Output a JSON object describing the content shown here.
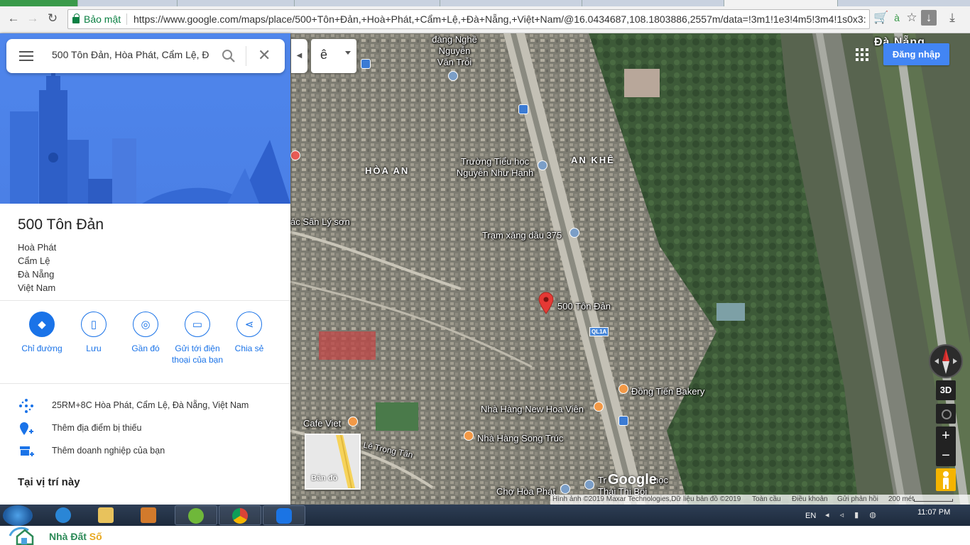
{
  "browser": {
    "secure_label": "Bảo mật",
    "url": "https://www.google.com/maps/place/500+Tôn+Đản,+Hoà+Phát,+Cẩm+Lệ,+Đà+Nẵng,+Việt+Nam/@16.0434687,108.1803886,2557m/data=!3m1!1e3!4m5!3m4!1s0x3:"
  },
  "search": {
    "value": "500 Tôn Đản, Hòa Phát, Cẩm Lệ, Đ"
  },
  "place": {
    "title": "500 Tôn Đản",
    "address_lines": [
      "Hoà Phát",
      "Cẩm Lệ",
      "Đà Nẵng",
      "Việt Nam"
    ]
  },
  "actions": [
    {
      "label": "Chỉ đường",
      "icon": "directions-icon"
    },
    {
      "label": "Lưu",
      "icon": "bookmark-icon"
    },
    {
      "label": "Gần đó",
      "icon": "nearby-icon"
    },
    {
      "label": "Gửi tới điện thoại của bạn",
      "icon": "send-to-phone-icon"
    },
    {
      "label": "Chia sẻ",
      "icon": "share-icon"
    }
  ],
  "info_rows": [
    {
      "text": "25RM+8C Hòa Phát, Cẩm Lệ, Đà Nẵng, Việt Nam",
      "icon": "plus-code-icon"
    },
    {
      "text": "Thêm địa điểm bị thiếu",
      "icon": "add-place-icon"
    },
    {
      "text": "Thêm doanh nghiệp của bạn",
      "icon": "add-business-icon"
    }
  ],
  "here_title": "Tại vị trí này",
  "layer_select": {
    "value": "ê"
  },
  "top_right": {
    "signin": "Đăng nhập",
    "city": "Đà Nẵng"
  },
  "map_labels": {
    "school_top": "đàng Nghề Nguyễn Văn Trỗi",
    "hoa_an": "HÒA AN",
    "an_khe": "AN KHÊ",
    "truong": "Trường Tiểu học Nguyễn Như Hạnh",
    "cac_san": "ác Sân Lý sơn",
    "tram": "Trạm xăng dầu 375",
    "pin": "500 Tôn Đản",
    "road": "QL1A",
    "bakery": "Đồng Tiến Bakery",
    "hoa_vien": "Nhà Hàng New Hoa Viên",
    "cafe": "Cafe Viet",
    "song_truc": "Nhà Hàng Song Trúc",
    "le_trong_tan": "Lê Trọng Tấn",
    "cho": "Chợ Hòa Phát",
    "tr_hoc": "Tr",
    "tr_hoc2": "học",
    "thai_thi": "Thái Thị Bôi"
  },
  "minimap_label": "Bản đồ",
  "map_controls": {
    "three_d": "3D",
    "zoom_in": "+",
    "zoom_out": "−"
  },
  "google_logo": "Google",
  "attribution": {
    "imagery": "Hình ảnh ©2019 Maxar Technologies,Dữ liệu bản đồ ©2019",
    "global": "Toàn cầu",
    "terms": "Điều khoản",
    "feedback": "Gửi phản hồi",
    "scale": "200 mét"
  },
  "taskbar": {
    "lang": "EN",
    "time": "11:07 PM"
  },
  "watermark": {
    "part1": "Nhà Đất ",
    "part2": "Số"
  }
}
